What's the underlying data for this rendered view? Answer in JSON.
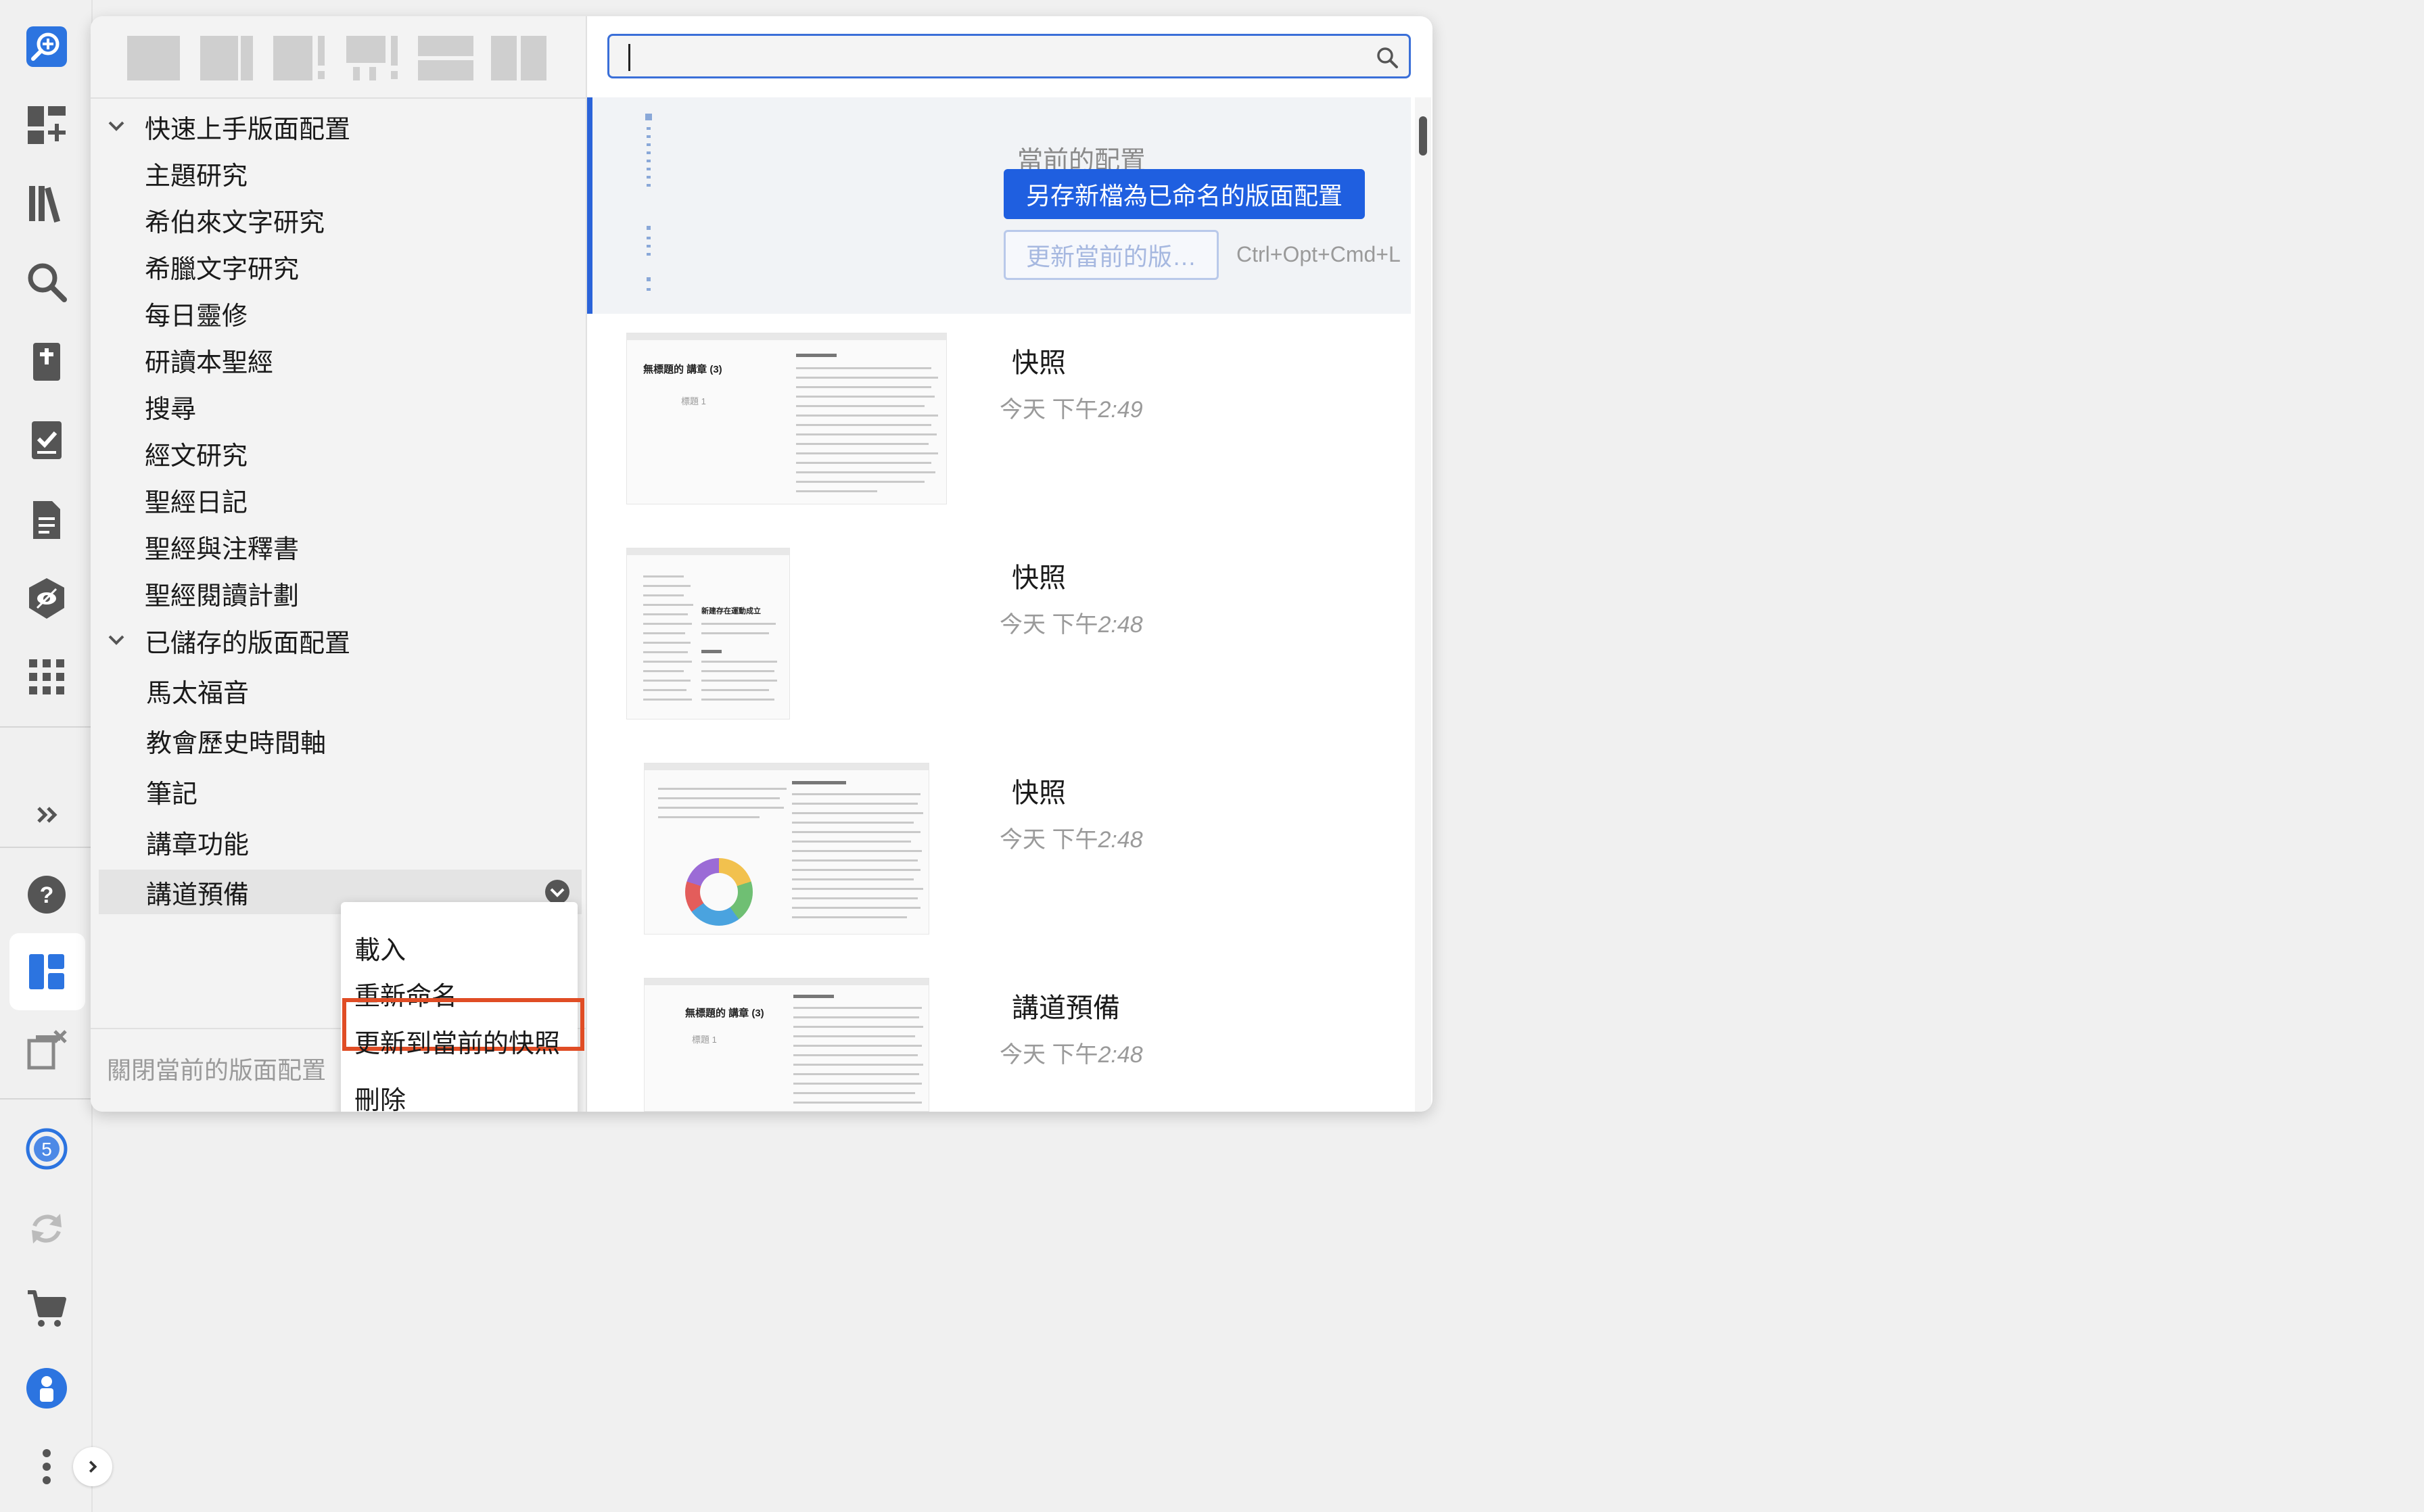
{
  "rail": {
    "icons": [
      "logos-search-icon",
      "dashboard-add-icon",
      "library-icon",
      "search-icon",
      "bible-icon",
      "checklist-icon",
      "document-icon",
      "shield-eye-icon",
      "apps-grid-icon",
      "expand-double-chevron-icon",
      "help-icon",
      "layouts-icon",
      "close-panels-icon",
      "notifications-icon",
      "sync-icon",
      "cart-icon",
      "account-icon",
      "more-icon",
      "expand-arrow-icon"
    ],
    "notification_count": "5",
    "accent": "#2c74e0"
  },
  "toolbar": {
    "layout_presets": [
      "single-panel-layout-icon",
      "two-panel-layout-icon",
      "panel-bang-layout-icon",
      "double-bang-layout-icon",
      "rows-layout-icon",
      "columns-layout-icon"
    ]
  },
  "tree": {
    "group_quickstart": "快速上手版面配置",
    "quickstart_items": [
      "主題研究",
      "希伯來文字研究",
      "希臘文字研究",
      "每日靈修",
      "研讀本聖經",
      "搜尋",
      "經文研究",
      "聖經日記",
      "聖經與注釋書",
      "聖經閱讀計劃"
    ],
    "group_saved": "已儲存的版面配置",
    "saved_items": [
      "馬太福音",
      "教會歷史時間軸",
      "筆記",
      "講章功能",
      "講道預備"
    ],
    "selected_item": "講道預備"
  },
  "context_menu": {
    "items": [
      "載入",
      "重新命名",
      "更新到當前的快照",
      "刪除"
    ],
    "highlighted": "更新到當前的快照",
    "highlight_color": "#e04d25"
  },
  "footer": {
    "close_layout": "關閉當前的版面配置"
  },
  "search": {
    "placeholder": ""
  },
  "current": {
    "title": "當前的配置",
    "save_new": "另存新檔為已命名的版面配置",
    "update_current": "更新當前的版…",
    "shortcut": "Ctrl+Opt+Cmd+L",
    "primary_color": "#1f5fe0"
  },
  "snapshots": [
    {
      "title": "快照",
      "time_prefix": "今天 下午",
      "time": "2:49",
      "thumb_heading": "無標題的 講章 (3)",
      "thumb_sub": "標題 1"
    },
    {
      "title": "快照",
      "time_prefix": "今天 下午",
      "time": "2:48",
      "thumb_heading": "新建存在運動成立",
      "thumb_sub": ""
    },
    {
      "title": "快照",
      "time_prefix": "今天 下午",
      "time": "2:48",
      "thumb_heading": "",
      "thumb_sub": ""
    },
    {
      "title": "講道預備",
      "time_prefix": "今天 下午",
      "time": "2:48",
      "thumb_heading": "無標題的 講章 (3)",
      "thumb_sub": "標題 1"
    }
  ]
}
